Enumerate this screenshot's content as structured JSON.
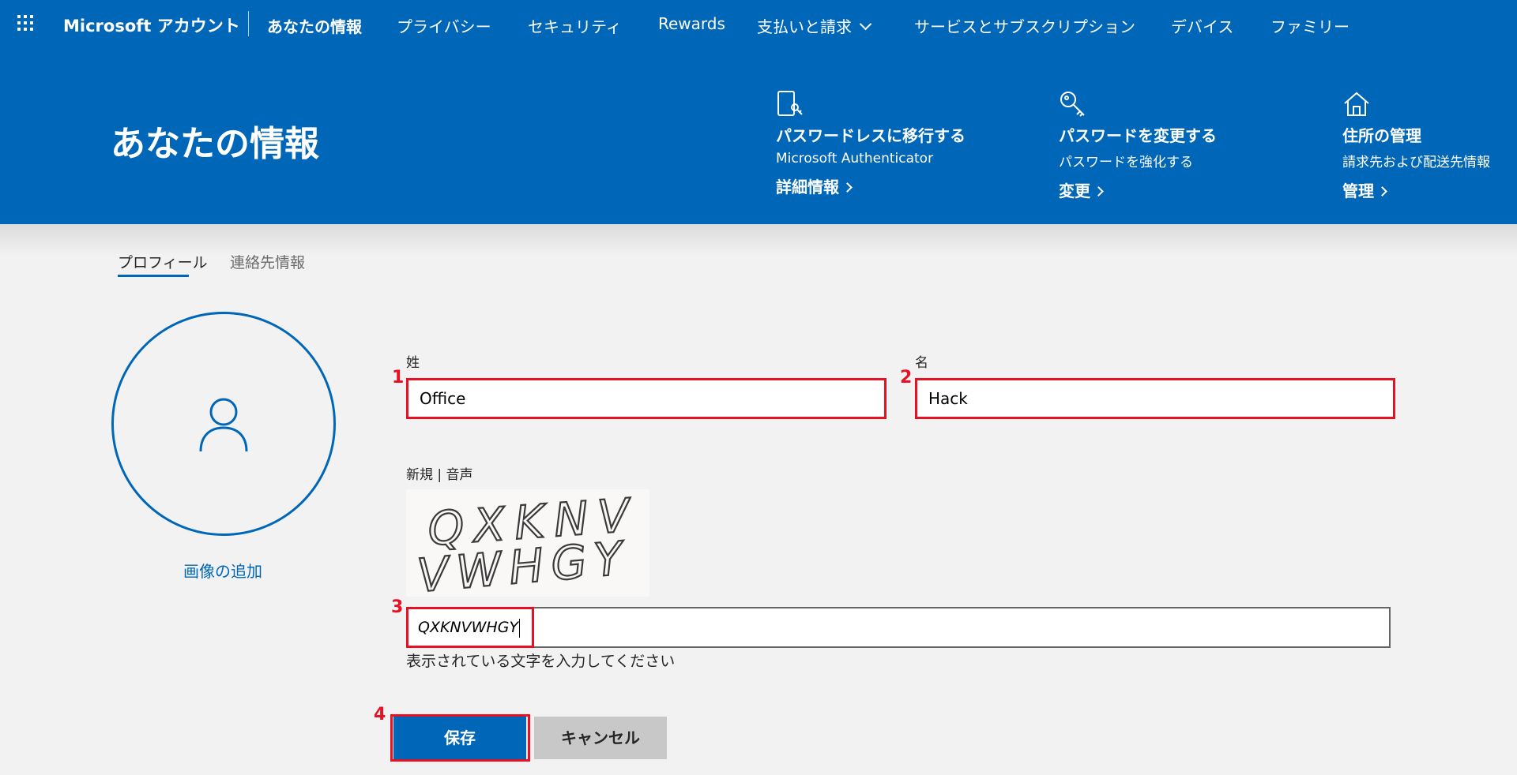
{
  "topnav": {
    "brand": "Microsoft アカウント",
    "items": [
      "あなたの情報",
      "プライバシー",
      "セキュリティ",
      "Rewards",
      "支払いと請求",
      "サービスとサブスクリプション",
      "デバイス",
      "ファミリー"
    ]
  },
  "hero": {
    "title": "あなたの情報",
    "quick": [
      {
        "icon": "passwordless-phone-icon",
        "title": "パスワードレスに移行する",
        "subtitle": "Microsoft Authenticator",
        "link": "詳細情報"
      },
      {
        "icon": "key-icon",
        "title": "パスワードを変更する",
        "subtitle": "パスワードを強化する",
        "link": "変更"
      },
      {
        "icon": "home-icon",
        "title": "住所の管理",
        "subtitle": "請求先および配送先情報",
        "link": "管理"
      }
    ]
  },
  "tabs": {
    "profile": "プロフィール",
    "contact": "連絡先情報"
  },
  "avatar": {
    "add_photo": "画像の追加"
  },
  "form": {
    "last_name_label": "姓",
    "last_name_value": "Office",
    "first_name_label": "名",
    "first_name_value": "Hack",
    "captcha_new": "新規",
    "captcha_sep": "|",
    "captcha_audio": "音声",
    "captcha_text": "QXKNV VWHGY",
    "captcha_value": "QXKNVWHGY",
    "captcha_help": "表示されている文字を入力してください",
    "save": "保存",
    "cancel": "キャンセル"
  },
  "annotations": [
    "1",
    "2",
    "3",
    "4"
  ],
  "colors": {
    "brand_blue": "#0067b8",
    "annotation_red": "#e81123"
  }
}
